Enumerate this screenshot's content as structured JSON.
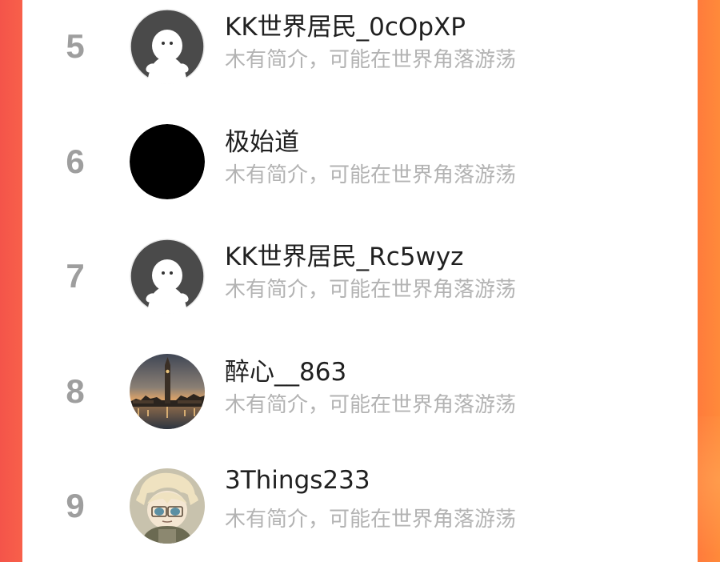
{
  "theme": {
    "accent": "#ff6a3c",
    "rank_color": "#9e9e9e",
    "name_color": "#202020",
    "bio_color": "#b3b3b3"
  },
  "leaderboard": {
    "rows": [
      {
        "rank": "5",
        "name": "KK世界居民_0cOpXP",
        "bio": "木有简介，可能在世界角落游荡",
        "avatar": "default-avatar-icon"
      },
      {
        "rank": "6",
        "name": "极始道",
        "bio": "木有简介，可能在世界角落游荡",
        "avatar": "black-avatar"
      },
      {
        "rank": "7",
        "name": "KK世界居民_Rc5wyz",
        "bio": "木有简介，可能在世界角落游荡",
        "avatar": "default-avatar-icon"
      },
      {
        "rank": "8",
        "name": "醉心__863",
        "bio": "木有简介，可能在世界角落游荡",
        "avatar": "city-photo-avatar"
      },
      {
        "rank": "9",
        "name": "3Things233",
        "bio": "木有简介，可能在世界角落游荡",
        "avatar": "anime-avatar"
      }
    ]
  }
}
